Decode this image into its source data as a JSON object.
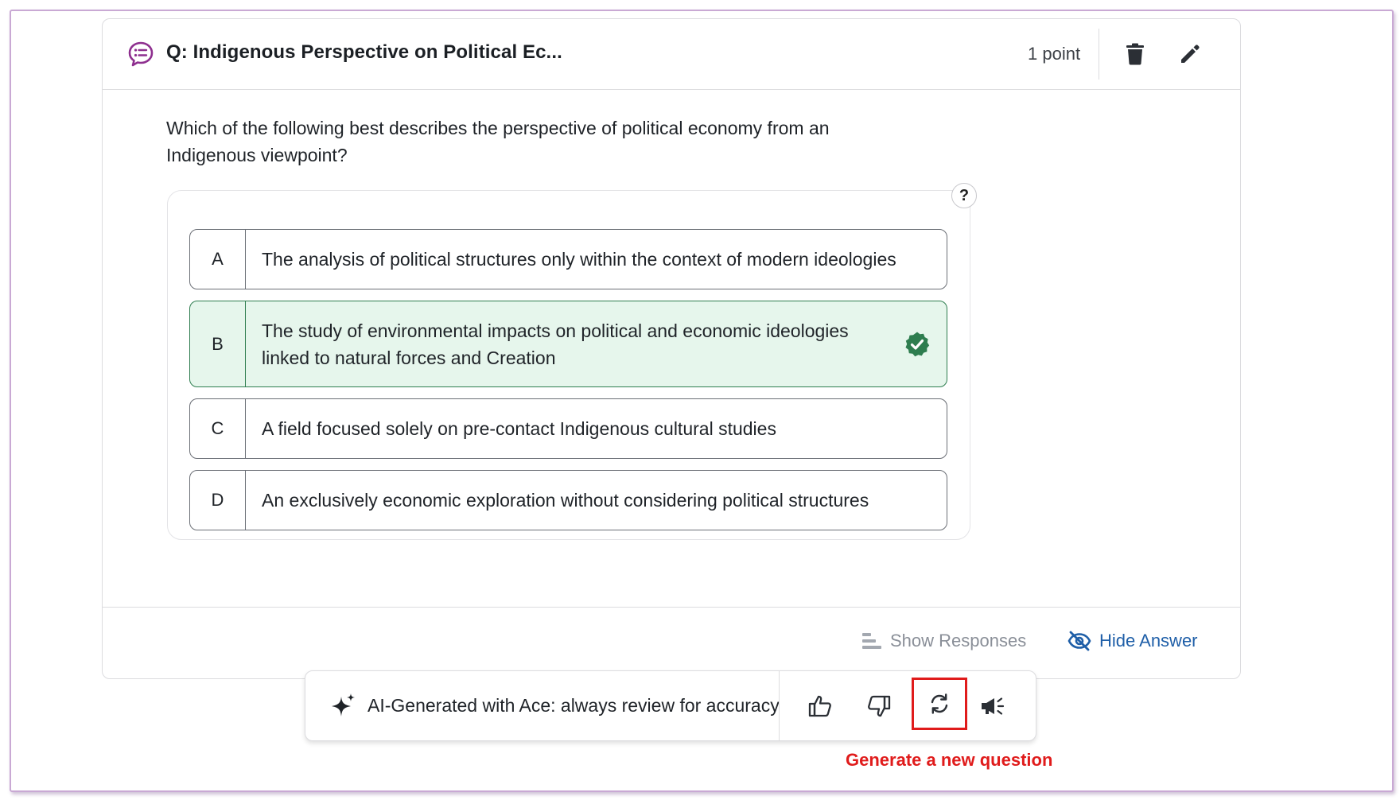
{
  "header": {
    "title": "Q: Indigenous Perspective on Political Ec...",
    "points": "1 point"
  },
  "question": {
    "text": "Which of the following best describes the perspective of political economy from an Indigenous viewpoint?",
    "help": "?"
  },
  "options": [
    {
      "letter": "A",
      "text": "The analysis of political structures only within the context of modern ideologies",
      "correct": false
    },
    {
      "letter": "B",
      "text": "The study of environmental impacts on political and economic ideologies linked to natural forces and Creation",
      "correct": true
    },
    {
      "letter": "C",
      "text": "A field focused solely on pre-contact Indigenous cultural studies",
      "correct": false
    },
    {
      "letter": "D",
      "text": "An exclusively economic exploration without considering political structures",
      "correct": false
    }
  ],
  "footer": {
    "show_responses": "Show Responses",
    "hide_answer": "Hide Answer"
  },
  "ai_bar": {
    "text": "AI-Generated with Ace: always review for accuracy"
  },
  "annotation": {
    "text": "Generate a new question"
  },
  "colors": {
    "accent_purple": "#8e2f8f",
    "correct_green": "#2e7d4f",
    "correct_bg": "#e6f6ec",
    "link_blue": "#1f5fa8",
    "annotation_red": "#e01b1b"
  },
  "icons": [
    "question-chat-icon",
    "trash-icon",
    "pencil-icon",
    "help-icon",
    "check-badge-icon",
    "bar-chart-icon",
    "eye-slash-icon",
    "sparkle-icon",
    "thumbs-up-icon",
    "thumbs-down-icon",
    "regenerate-icon",
    "megaphone-icon"
  ]
}
